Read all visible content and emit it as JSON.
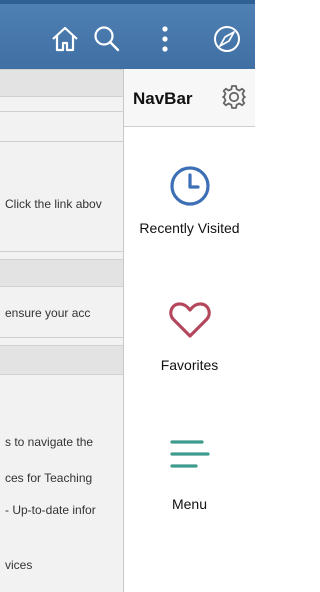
{
  "topbar": {
    "icons": [
      "home-icon",
      "search-icon",
      "more-vertical-icon",
      "navbar-compass-icon"
    ]
  },
  "background": {
    "lines": [
      "Click the link abov",
      "ensure your acc",
      "s to navigate the",
      "ces for Teaching",
      "- Up-to-date infor",
      "vices"
    ]
  },
  "navbar": {
    "title": "NavBar",
    "items": [
      {
        "label": "Recently Visited",
        "icon": "clock-icon",
        "color": "#3d6fb6"
      },
      {
        "label": "Favorites",
        "icon": "heart-icon",
        "color": "#b5475d"
      },
      {
        "label": "Menu",
        "icon": "menu-icon",
        "color": "#3d9c8e"
      }
    ]
  },
  "colors": {
    "topbar": "#4a7aae",
    "panel_header": "#f7f7f7"
  }
}
